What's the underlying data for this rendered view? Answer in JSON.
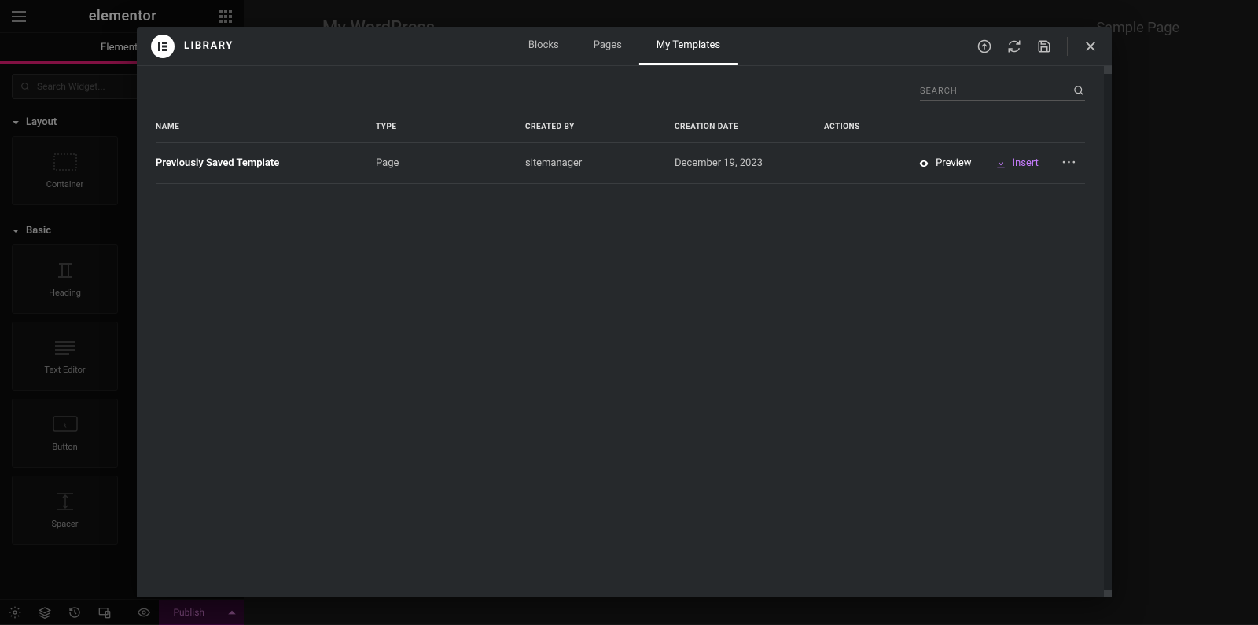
{
  "sidebar": {
    "logo": "elementor",
    "tabs": {
      "elements": "Elements"
    },
    "search_placeholder": "Search Widget...",
    "sections": {
      "layout": {
        "title": "Layout",
        "widgets": [
          "Container"
        ]
      },
      "basic": {
        "title": "Basic",
        "widgets": [
          "Heading",
          "Text Editor",
          "Button",
          "Spacer"
        ]
      }
    },
    "publish_label": "Publish"
  },
  "canvas": {
    "site_title": "My WordPress",
    "page_link": "Sample Page"
  },
  "modal": {
    "title": "LIBRARY",
    "tabs": [
      "Blocks",
      "Pages",
      "My Templates"
    ],
    "active_tab": 2,
    "search_placeholder": "SEARCH",
    "columns": [
      "NAME",
      "TYPE",
      "CREATED BY",
      "CREATION DATE",
      "ACTIONS"
    ],
    "rows": [
      {
        "name": "Previously Saved Template",
        "type": "Page",
        "created_by": "sitemanager",
        "creation_date": "December 19, 2023"
      }
    ],
    "actions": {
      "preview": "Preview",
      "insert": "Insert"
    }
  }
}
